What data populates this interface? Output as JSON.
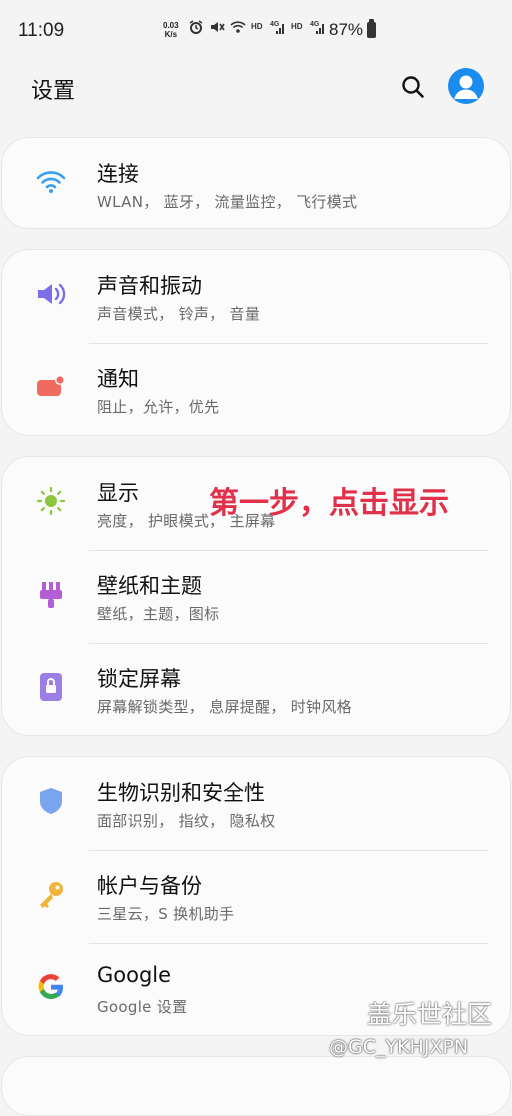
{
  "status_bar": {
    "time": "11:09",
    "net_speed_value": "0.03",
    "net_speed_unit": "K/s",
    "battery": "87%",
    "icons": [
      "alarm-icon",
      "mute-icon",
      "wifi-icon",
      "hd-icon",
      "signal-4g-icon",
      "hd-icon",
      "signal-4g-icon",
      "battery-icon"
    ]
  },
  "header": {
    "title": "设置",
    "search_icon": "search-icon",
    "avatar_icon": "account-icon",
    "accent": "#1a8cf0"
  },
  "groups": [
    {
      "items": [
        {
          "icon": "wifi-icon",
          "color": "#3aa0f2",
          "title": "连接",
          "subtitle": "WLAN， 蓝牙， 流量监控， 飞行模式"
        }
      ]
    },
    {
      "items": [
        {
          "icon": "volume-icon",
          "color": "#7b6fe8",
          "title": "声音和振动",
          "subtitle": "声音模式， 铃声， 音量"
        },
        {
          "icon": "notification-icon",
          "color": "#ef6b5f",
          "title": "通知",
          "subtitle": "阻止，允许，优先"
        }
      ]
    },
    {
      "items": [
        {
          "icon": "brightness-icon",
          "color": "#8cc63f",
          "title": "显示",
          "subtitle": "亮度， 护眼模式， 主屏幕"
        },
        {
          "icon": "wallpaper-brush-icon",
          "color": "#b25fd6",
          "title": "壁纸和主题",
          "subtitle": "壁纸，主题，图标"
        },
        {
          "icon": "lock-screen-icon",
          "color": "#9b7fe6",
          "title": "锁定屏幕",
          "subtitle": "屏幕解锁类型， 息屏提醒， 时钟风格"
        }
      ]
    },
    {
      "items": [
        {
          "icon": "shield-icon",
          "color": "#7aa4ee",
          "title": "生物识别和安全性",
          "subtitle": "面部识别， 指纹， 隐私权"
        },
        {
          "icon": "key-icon",
          "color": "#f0b43a",
          "title": "帐户与备份",
          "subtitle": "三星云，S 换机助手"
        },
        {
          "icon": "google-icon",
          "color": "#4285f4",
          "title": "Google",
          "subtitle": "Google 设置"
        }
      ]
    }
  ],
  "annotation": "第一步，点击显示",
  "watermark": {
    "site": "盖乐世社区",
    "user": "@GC_YKHJXPN"
  }
}
